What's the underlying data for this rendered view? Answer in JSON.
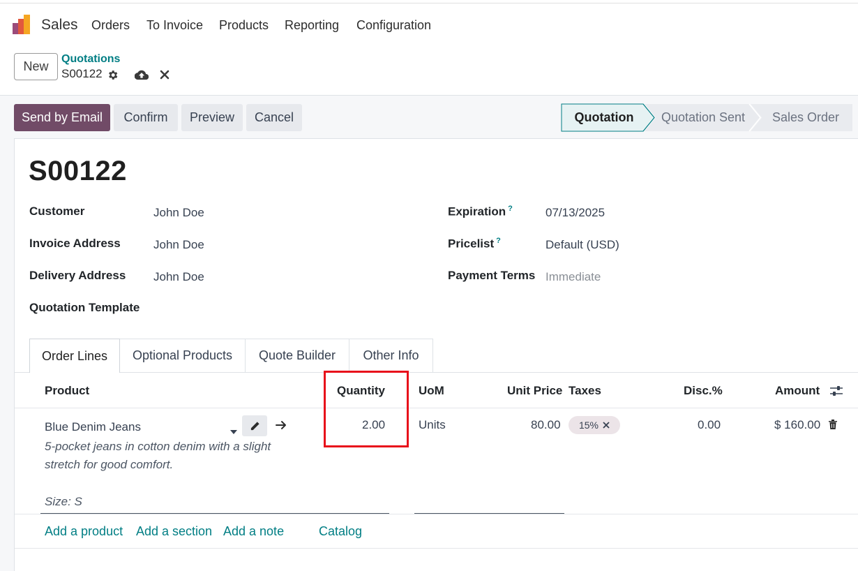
{
  "app": {
    "name": "Sales",
    "logo_icon": "odoo-sales-logo"
  },
  "nav": {
    "items": [
      "Orders",
      "To Invoice",
      "Products",
      "Reporting",
      "Configuration"
    ]
  },
  "control_panel": {
    "new_label": "New",
    "breadcrumb": "Quotations",
    "record_name": "S00122",
    "icons": [
      "gear-icon",
      "cloud-upload-icon",
      "close-icon"
    ]
  },
  "actions": {
    "send_email": "Send by Email",
    "confirm": "Confirm",
    "preview": "Preview",
    "cancel": "Cancel"
  },
  "status": {
    "steps": [
      "Quotation",
      "Quotation Sent",
      "Sales Order"
    ],
    "active": "Quotation"
  },
  "form": {
    "title": "S00122",
    "left_fields": [
      {
        "label": "Customer",
        "value": "John Doe"
      },
      {
        "label": "Invoice Address",
        "value": "John Doe"
      },
      {
        "label": "Delivery Address",
        "value": "John Doe"
      },
      {
        "label": "Quotation Template",
        "value": ""
      }
    ],
    "right_fields": [
      {
        "label": "Expiration",
        "help": "?",
        "value": "07/13/2025"
      },
      {
        "label": "Pricelist",
        "help": "?",
        "value": "Default (USD)"
      },
      {
        "label": "Payment Terms",
        "value": "Immediate"
      }
    ]
  },
  "tabs": [
    "Order Lines",
    "Optional Products",
    "Quote Builder",
    "Other Info"
  ],
  "table": {
    "headers": {
      "product": "Product",
      "quantity": "Quantity",
      "uom": "UoM",
      "unit_price": "Unit Price",
      "taxes": "Taxes",
      "discount": "Disc.%",
      "amount": "Amount"
    },
    "line": {
      "product": "Blue Denim Jeans",
      "description_1": "5-pocket jeans in cotton denim with a slight",
      "description_2": "stretch for good comfort.",
      "variant": "Size: S",
      "quantity": "2.00",
      "uom": "Units",
      "unit_price": "80.00",
      "tax": "15%",
      "discount": "0.00",
      "amount": "$ 160.00"
    },
    "links": {
      "add_product": "Add a product",
      "add_section": "Add a section",
      "add_note": "Add a note",
      "catalog": "Catalog"
    }
  },
  "colors": {
    "brand": "#714b67",
    "link": "#017e84",
    "highlight": "#e8101b",
    "active_step_bg": "#e6f2f3"
  }
}
